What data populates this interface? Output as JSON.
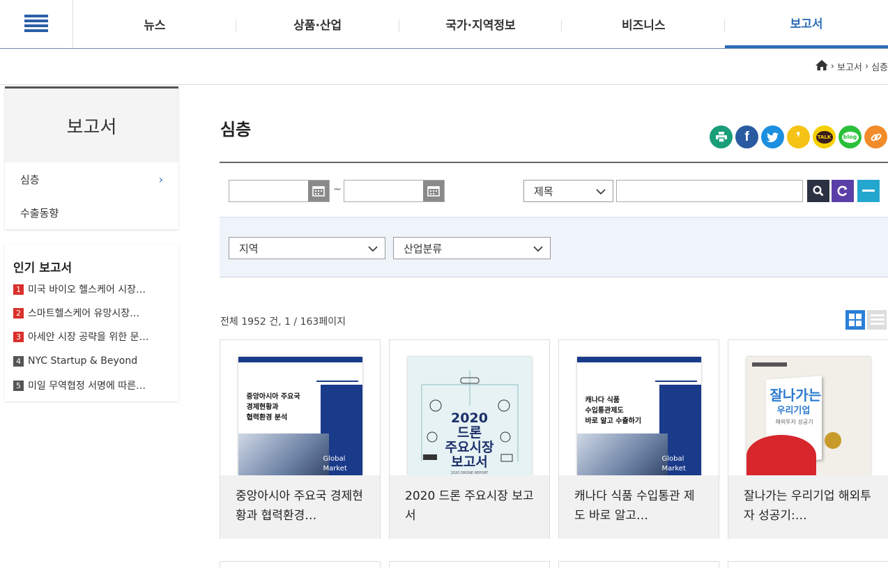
{
  "nav": {
    "menu_icon": "hamburger-icon",
    "items": [
      "뉴스",
      "상품·산업",
      "국가·지역정보",
      "비즈니스",
      "보고서"
    ],
    "active": "보고서"
  },
  "breadcrumb": {
    "home_icon": "home-icon",
    "level1": "보고서",
    "level2": "심층"
  },
  "sidebar": {
    "title": "보고서",
    "items": [
      {
        "label": "심층",
        "chevron": "›"
      },
      {
        "label": "수출동향"
      }
    ]
  },
  "popular": {
    "title": "인기 보고서",
    "items": [
      {
        "num": "1",
        "text": "미국 바이오 헬스케어 시장…",
        "color": "#d9302b"
      },
      {
        "num": "2",
        "text": "스마트헬스케어 유망시장…",
        "color": "#d9302b"
      },
      {
        "num": "3",
        "text": "아세안 시장 공략을 위한 문…",
        "color": "#d9302b"
      },
      {
        "num": "4",
        "text": "NYC Startup & Beyond",
        "color": "#555555"
      },
      {
        "num": "5",
        "text": "미일 무역협정 서명에 따른…",
        "color": "#555555"
      }
    ]
  },
  "main": {
    "title": "심층"
  },
  "share": [
    {
      "icon": "print-icon",
      "color": "#1a9e7a",
      "glyph": "⎙"
    },
    {
      "icon": "facebook-icon",
      "color": "#2a5aa0",
      "glyph": "f"
    },
    {
      "icon": "twitter-icon",
      "color": "#1d8fe0",
      "glyph": "t"
    },
    {
      "icon": "kakaostory-icon",
      "color": "#f5c316",
      "glyph": "❜"
    },
    {
      "icon": "kakaotalk-icon",
      "color": "#f5d000",
      "glyph": "TALK"
    },
    {
      "icon": "blog-icon",
      "color": "#2ac03a",
      "glyph": "blog"
    },
    {
      "icon": "link-icon",
      "color": "#f28b2a",
      "glyph": "🔗"
    }
  ],
  "search": {
    "date_sep": "~",
    "field_select": "제목",
    "region_select": "지역",
    "industry_select": "산업분류",
    "calendar_icon": "calendar-icon",
    "search_icon": "search-icon",
    "reset_icon": "refresh-icon",
    "collapse_icon": "minus-icon"
  },
  "list": {
    "count_text": "전체 1952 건, 1 / 163페이지",
    "grid_icon": "grid-view-icon",
    "list_icon": "list-view-icon"
  },
  "cards": [
    {
      "title": "중앙아시아 주요국 경제현황과 협력환경…",
      "cover_text": [
        "중앙아시아 주요국",
        "경제현황과",
        "협력환경 분석"
      ],
      "cover_side": "Global Market"
    },
    {
      "title": "2020 드론 주요시장 보고서",
      "cover_text": [
        "2020",
        "드론",
        "주요시장",
        "보고서"
      ],
      "cover_side": "2020 DRONE REPORT"
    },
    {
      "title": "캐나다 식품 수입통관 제도 바로 알고…",
      "cover_text": [
        "캐나다 식품",
        "수입통관제도",
        "바로 알고 수출하기"
      ],
      "cover_side": "Global Market"
    },
    {
      "title": "잘나가는 우리기업 해외투자 성공기:…",
      "cover_text": [
        "잘나가는",
        "우리기업",
        "해외투자 성공기"
      ],
      "cover_side": ""
    }
  ]
}
